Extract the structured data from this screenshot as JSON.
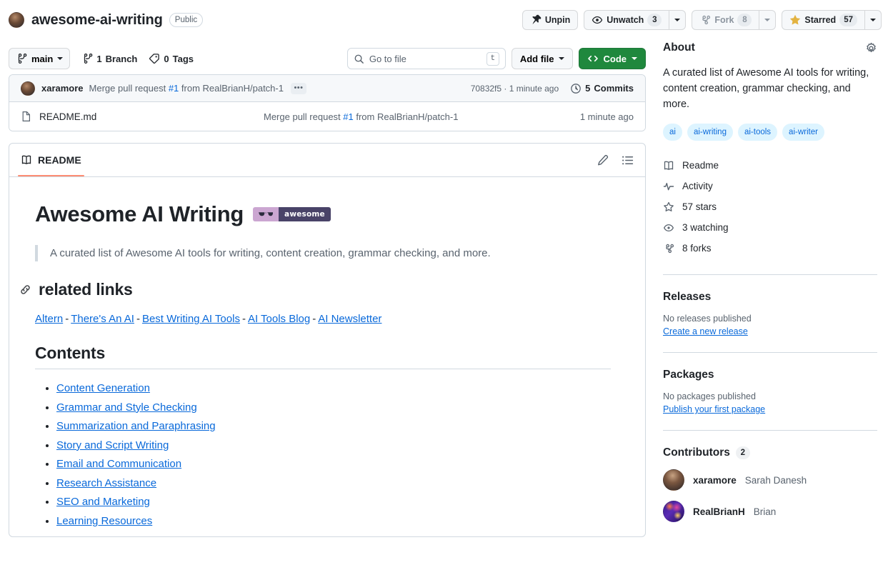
{
  "repo": {
    "owner_avatar": "owner-avatar",
    "name": "awesome-ai-writing",
    "visibility": "Public"
  },
  "header_actions": {
    "unpin_label": "Unpin",
    "unwatch_label": "Unwatch",
    "unwatch_count": "3",
    "fork_label": "Fork",
    "fork_count": "8",
    "star_label": "Starred",
    "star_count": "57"
  },
  "file_nav": {
    "branch": "main",
    "branches_count": "1",
    "branches_label": "Branch",
    "tags_count": "0",
    "tags_label": "Tags",
    "search_placeholder": "Go to file",
    "search_value": "",
    "search_kbd": "t",
    "add_file_label": "Add file",
    "code_label": "Code"
  },
  "commit": {
    "author": "xaramore",
    "message_prefix": "Merge pull request ",
    "pr_number": "#1",
    "message_suffix": " from RealBrianH/patch-1",
    "expand_label": "•••",
    "sha": "70832f5",
    "sha_sep": " · ",
    "time": "1 minute ago",
    "commits_count": "5",
    "commits_label": "Commits"
  },
  "files": [
    {
      "name": "README.md",
      "commit_prefix": "Merge pull request ",
      "commit_pr": "#1",
      "commit_suffix": " from RealBrianH/patch-1",
      "time": "1 minute ago"
    }
  ],
  "readme": {
    "tab_label": "README",
    "title": "Awesome AI Writing",
    "badge_text": "awesome",
    "blockquote": "A curated list of Awesome AI tools for writing, content creation, grammar checking, and more.",
    "related_links_heading": "related links",
    "related_links": [
      {
        "label": "Altern"
      },
      {
        "label": "There's An AI"
      },
      {
        "label": "Best Writing AI Tools"
      },
      {
        "label": "AI Tools Blog"
      },
      {
        "label": "AI Newsletter"
      }
    ],
    "link_separator": "-",
    "contents_heading": "Contents",
    "contents": [
      {
        "label": "Content Generation"
      },
      {
        "label": "Grammar and Style Checking"
      },
      {
        "label": "Summarization and Paraphrasing"
      },
      {
        "label": "Story and Script Writing"
      },
      {
        "label": "Email and Communication"
      },
      {
        "label": "Research Assistance"
      },
      {
        "label": "SEO and Marketing"
      },
      {
        "label": "Learning Resources"
      }
    ]
  },
  "sidebar": {
    "about_heading": "About",
    "description": "A curated list of Awesome AI tools for writing, content creation, grammar checking, and more.",
    "topics": [
      {
        "label": "ai"
      },
      {
        "label": "ai-writing"
      },
      {
        "label": "ai-tools"
      },
      {
        "label": "ai-writer"
      }
    ],
    "links": [
      {
        "label": "Readme",
        "icon": "book-icon"
      },
      {
        "label": "Activity",
        "icon": "pulse-icon"
      },
      {
        "label": "57 stars",
        "icon": "star-icon"
      },
      {
        "label": "3 watching",
        "icon": "eye-icon"
      },
      {
        "label": "8 forks",
        "icon": "fork-icon"
      }
    ],
    "releases": {
      "heading": "Releases",
      "empty": "No releases published",
      "cta": "Create a new release"
    },
    "packages": {
      "heading": "Packages",
      "empty": "No packages published",
      "cta": "Publish your first package"
    },
    "contributors": {
      "heading": "Contributors",
      "count": "2",
      "people": [
        {
          "username": "xaramore",
          "fullname": "Sarah Danesh"
        },
        {
          "username": "RealBrianH",
          "fullname": "Brian"
        }
      ]
    }
  },
  "colors": {
    "accent_green": "#1f883d",
    "link_blue": "#0969da",
    "tab_underline": "#fd8c73",
    "topic_bg": "#ddf4ff",
    "border": "#d1d9e0",
    "badge_left": "#cba6d1",
    "badge_right": "#494368"
  }
}
